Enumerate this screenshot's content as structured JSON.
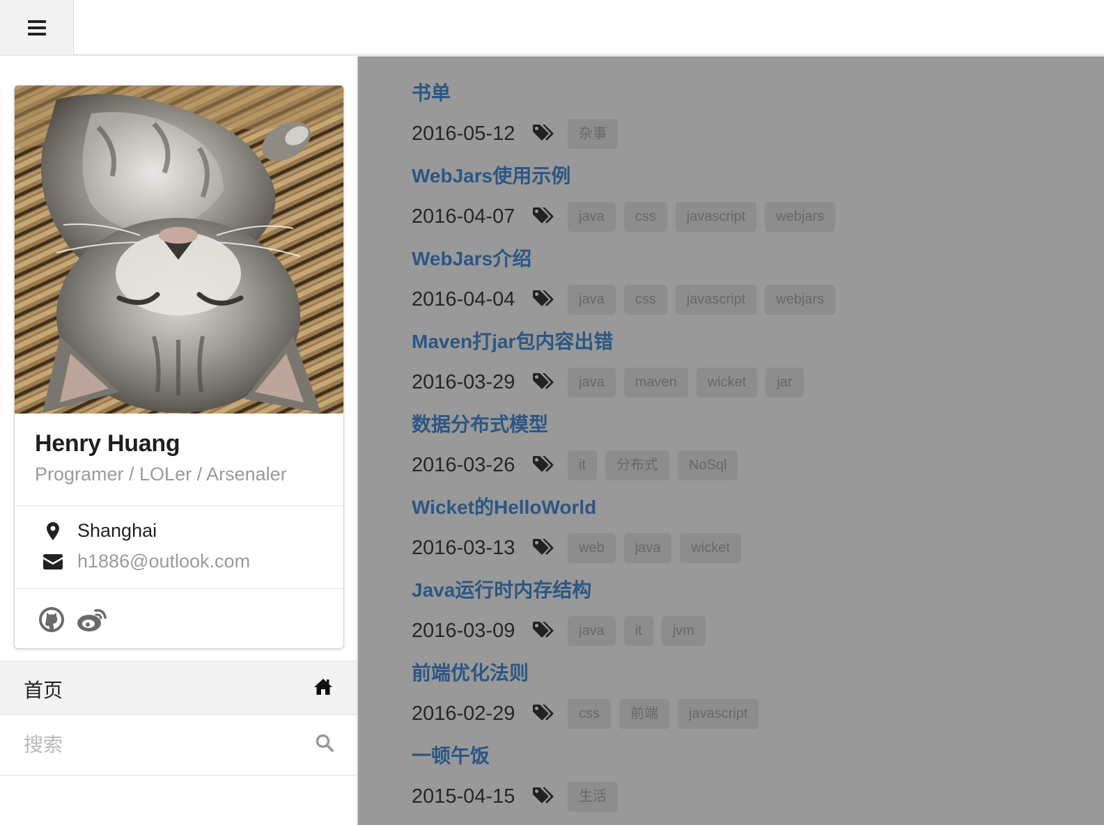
{
  "header": {
    "menu_icon": "hamburger-icon"
  },
  "profile": {
    "name": "Henry Huang",
    "tagline": "Programer / LOLer / Arsenaler",
    "location": "Shanghai",
    "email": "h1886@outlook.com",
    "location_icon": "map-marker-icon",
    "email_icon": "envelope-icon",
    "social_icons": [
      "github-icon",
      "weibo-icon"
    ]
  },
  "nav": {
    "home_label": "首页",
    "home_icon": "home-icon",
    "search_placeholder": "搜索",
    "search_icon": "search-icon"
  },
  "colors": {
    "title_link": "#2b5684",
    "content_overlay": "#999999",
    "tag_background": "#8d8d8d",
    "nav_active_bg": "#f2f2f2"
  },
  "posts": [
    {
      "title": "书单",
      "date": "2016-05-12",
      "tags": [
        "杂事"
      ]
    },
    {
      "title": "WebJars使用示例",
      "date": "2016-04-07",
      "tags": [
        "java",
        "css",
        "javascript",
        "webjars"
      ]
    },
    {
      "title": "WebJars介绍",
      "date": "2016-04-04",
      "tags": [
        "java",
        "css",
        "javascript",
        "webjars"
      ]
    },
    {
      "title": "Maven打jar包内容出错",
      "date": "2016-03-29",
      "tags": [
        "java",
        "maven",
        "wicket",
        "jar"
      ]
    },
    {
      "title": "数据分布式模型",
      "date": "2016-03-26",
      "tags": [
        "it",
        "分布式",
        "NoSql"
      ]
    },
    {
      "title": "Wicket的HelloWorld",
      "date": "2016-03-13",
      "tags": [
        "web",
        "java",
        "wicket"
      ]
    },
    {
      "title": "Java运行时内存结构",
      "date": "2016-03-09",
      "tags": [
        "java",
        "it",
        "jvm"
      ]
    },
    {
      "title": "前端优化法则",
      "date": "2016-02-29",
      "tags": [
        "css",
        "前端",
        "javascript"
      ]
    },
    {
      "title": "一顿午饭",
      "date": "2015-04-15",
      "tags": [
        "生活"
      ]
    }
  ]
}
